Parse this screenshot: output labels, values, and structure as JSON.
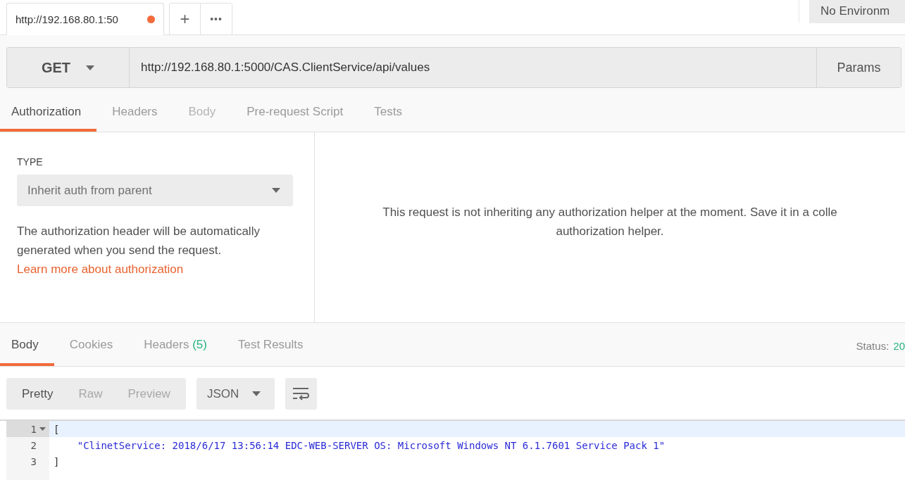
{
  "request_tabs": [
    {
      "title": "http://192.168.80.1:50",
      "unsaved": true,
      "selected": true
    }
  ],
  "tab_actions": [
    "+",
    "•••"
  ],
  "environment": {
    "label": "No Environm"
  },
  "request": {
    "method": "GET",
    "url": "http://192.168.80.1:5000/CAS.ClientService/api/values",
    "params_button": "Params"
  },
  "request_sections": [
    {
      "label": "Authorization",
      "selected": true,
      "disabled": false
    },
    {
      "label": "Headers",
      "selected": false,
      "disabled": false
    },
    {
      "label": "Body",
      "selected": false,
      "disabled": true
    },
    {
      "label": "Pre-request Script",
      "selected": false,
      "disabled": false
    },
    {
      "label": "Tests",
      "selected": false,
      "disabled": false
    }
  ],
  "authorization": {
    "type_label": "TYPE",
    "type_value": "Inherit auth from parent",
    "description": "The authorization header will be automatically generated when you send the request.",
    "link": "Learn more about authorization",
    "message_lines": [
      "This request is not inheriting any authorization helper at the moment. Save it in a colle",
      "authorization helper."
    ]
  },
  "response_sections": [
    {
      "label": "Body",
      "selected": true
    },
    {
      "label": "Cookies",
      "selected": false
    },
    {
      "label": "Headers",
      "count": "(5)",
      "selected": false
    },
    {
      "label": "Test Results",
      "selected": false
    }
  ],
  "status": {
    "label": "Status:",
    "value": "20"
  },
  "view_modes": [
    {
      "label": "Pretty",
      "selected": true
    },
    {
      "label": "Raw",
      "selected": false
    },
    {
      "label": "Preview",
      "selected": false
    }
  ],
  "format": {
    "value": "JSON"
  },
  "code_lines": [
    {
      "number": "1",
      "text": "[",
      "active": true,
      "foldable": true,
      "kind": "punct"
    },
    {
      "number": "2",
      "text": "    \"ClinetService: 2018/6/17 13:56:14 EDC-WEB-SERVER OS: Microsoft Windows NT 6.1.7601 Service Pack 1\"",
      "active": false,
      "foldable": false,
      "kind": "string"
    },
    {
      "number": "3",
      "text": "]",
      "active": false,
      "foldable": false,
      "kind": "punct"
    }
  ]
}
